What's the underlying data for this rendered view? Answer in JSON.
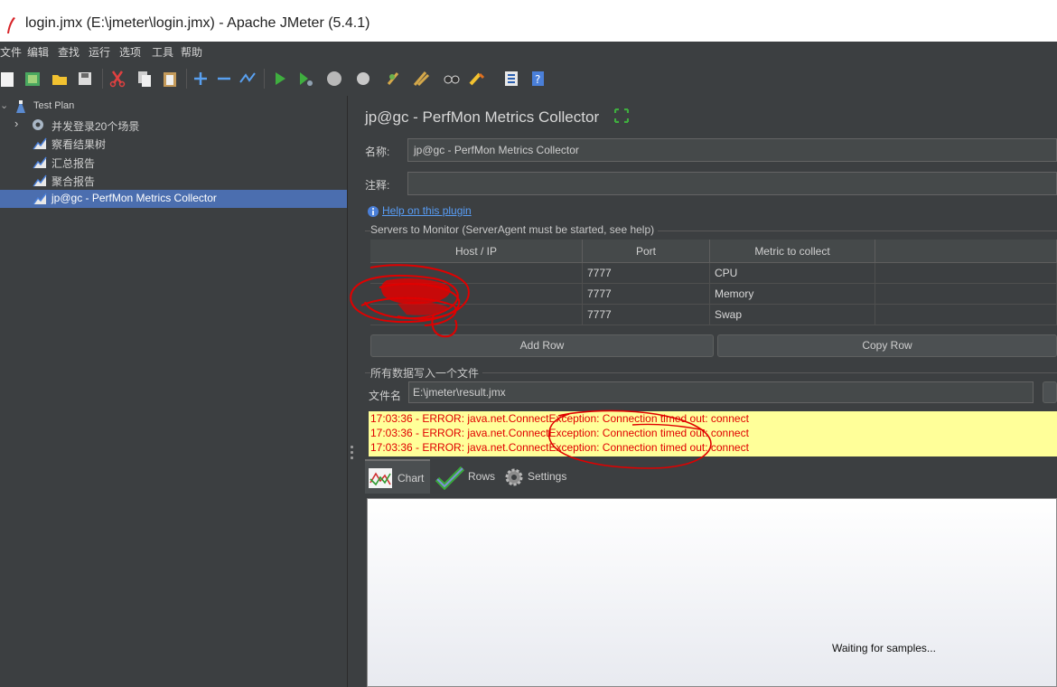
{
  "window": {
    "title": "login.jmx (E:\\jmeter\\login.jmx) - Apache JMeter (5.4.1)"
  },
  "menu": [
    "文件",
    "编辑",
    "查找",
    "运行",
    "选项",
    "工具",
    "帮助"
  ],
  "toolbar_icons": [
    "new-icon",
    "templates-icon",
    "open-icon",
    "save-icon",
    "cut-icon",
    "copy-icon",
    "paste-icon",
    "expand-icon",
    "collapse-icon",
    "toggle-icon",
    "start-icon",
    "start-no-pause-icon",
    "stop-icon",
    "shutdown-icon",
    "clear-icon",
    "clear-all-icon",
    "search-icon",
    "reset-search-icon",
    "function-helper-icon",
    "help-icon"
  ],
  "tree": {
    "items": [
      {
        "label": "Test Plan",
        "icon": "test-plan-icon"
      },
      {
        "label": "并发登录20个场景",
        "icon": "thread-group-gear-icon"
      },
      {
        "label": "察看结果树",
        "icon": "listener-icon"
      },
      {
        "label": "汇总报告",
        "icon": "listener-icon"
      },
      {
        "label": "聚合报告",
        "icon": "listener-icon"
      },
      {
        "label": "jp@gc - PerfMon Metrics Collector",
        "icon": "listener-icon",
        "selected": true
      }
    ]
  },
  "panel": {
    "title": "jp@gc - PerfMon Metrics Collector",
    "name_label": "名称:",
    "name_value": "jp@gc - PerfMon Metrics Collector",
    "comment_label": "注释:",
    "comment_value": "",
    "help_link": "Help on this plugin",
    "servers_section": "Servers to Monitor (ServerAgent must be started, see help)",
    "table": {
      "headers": [
        "Host / IP",
        "Port",
        "Metric to collect",
        ""
      ],
      "rows": [
        [
          "",
          "7777",
          "CPU",
          ""
        ],
        [
          "",
          "7777",
          "Memory",
          ""
        ],
        [
          "",
          "7777",
          "Swap",
          ""
        ]
      ]
    },
    "add_row": "Add Row",
    "copy_row": "Copy Row",
    "file_section": "所有数据写入一个文件",
    "file_label": "文件名",
    "file_value": "E:\\jmeter\\result.jmx",
    "log_lines": [
      "17:03:36 - ERROR: java.net.ConnectException: Connection timed out: connect",
      "17:03:36 - ERROR: java.net.ConnectException: Connection timed out: connect",
      "17:03:36 - ERROR: java.net.ConnectException: Connection timed out: connect"
    ],
    "tabs": [
      {
        "label": "Chart",
        "icon": "chart-icon"
      },
      {
        "label": "Rows",
        "icon": "checkmark-icon"
      },
      {
        "label": "Settings",
        "icon": "gear-icon"
      }
    ],
    "chart_message": "Waiting for samples..."
  }
}
